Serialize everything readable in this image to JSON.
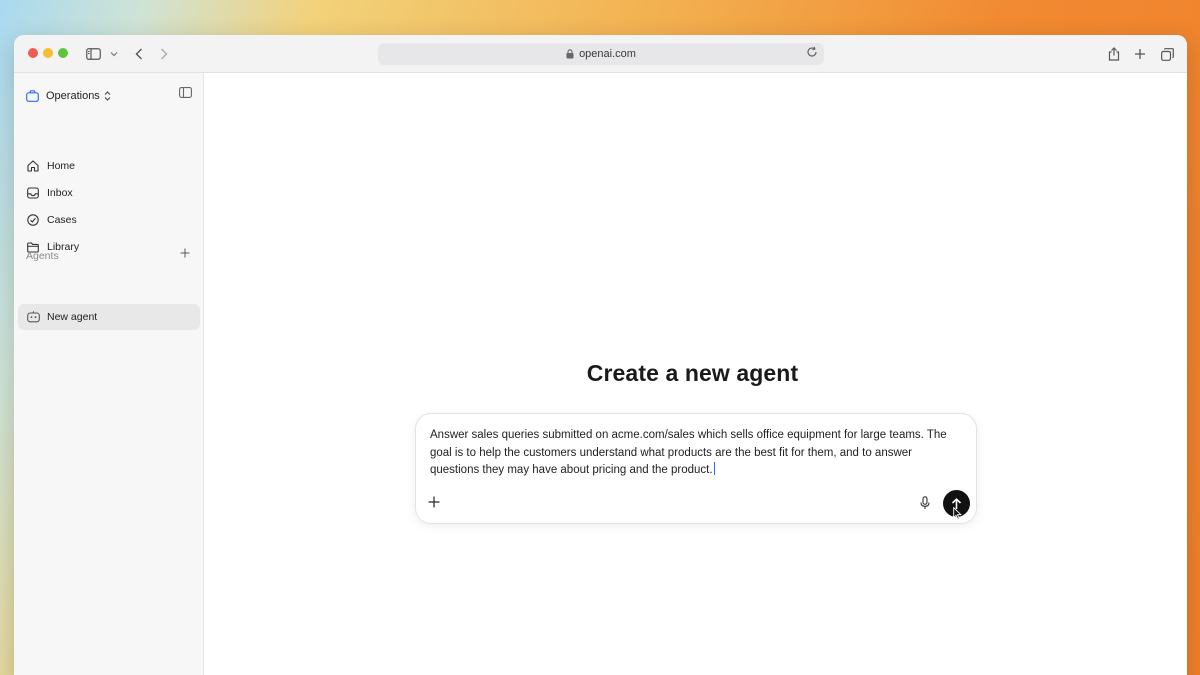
{
  "browser": {
    "url": "openai.com"
  },
  "sidebar": {
    "workspace": "Operations",
    "nav": [
      {
        "label": "Home",
        "icon": "home-icon"
      },
      {
        "label": "Inbox",
        "icon": "inbox-icon"
      },
      {
        "label": "Cases",
        "icon": "check-circle-icon"
      },
      {
        "label": "Library",
        "icon": "folder-icon"
      }
    ],
    "agents_label": "Agents",
    "agents": [
      {
        "label": "New agent",
        "icon": "bot-icon"
      }
    ]
  },
  "main": {
    "heading": "Create a new agent",
    "composer": {
      "value": "Answer sales queries submitted on acme.com/sales which sells office equipment for large teams. The goal is to help the customers understand what products are the best fit for them, and to answer questions they may have about pricing and the product."
    }
  },
  "colors": {
    "accent": "#2a6df4",
    "send_button": "#111111",
    "selected_item": "#e8e8e8"
  }
}
